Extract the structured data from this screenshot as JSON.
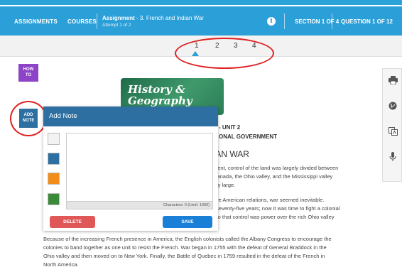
{
  "nav": {
    "assignments": "ASSIGNMENTS",
    "courses": "COURSES",
    "assignment_label": "Assignment",
    "assignment_name": "- 3. French and Indian War",
    "attempt": "Attempt 1 of 2",
    "info_icon": "i",
    "section": "SECTION 1 OF 4",
    "question": "QUESTION 1 OF 12"
  },
  "pager": {
    "pages": [
      "1",
      "2",
      "3",
      "4"
    ],
    "current": "1"
  },
  "left_buttons": {
    "how_to": [
      "HOW",
      "TO"
    ],
    "add_note": [
      "ADD",
      "NOTE"
    ]
  },
  "tools": [
    "print-icon",
    "globe-icon",
    "translate-icon",
    "microphone-icon"
  ],
  "banner": {
    "line1": "History &",
    "line2": "Geography"
  },
  "content": {
    "unit_line1": "- UNIT 2",
    "unit_line2": "ONAL GOVERNMENT",
    "heading": "IAN WAR",
    "para1": [
      "ment, control of the land was largely divided between",
      "Canada, the Ohio valley, and the Mississippi valley",
      "ery large."
    ],
    "para2": [
      "tive American relations, war seemed inevitable.",
      "f seventy-five years; now it was time to fight a colonial",
      "r to that control was power over the rich Ohio valley"
    ],
    "bottom": [
      "Because of the increasing French presence in America, the English colonists called the Albany Congress to encourage the",
      "colonies to band together as one unit to resist the French. War began in 1755 with the defeat of General Braddock in the",
      "Ohio valley and then moved on to New York. Finally, the Battle of Quebec in 1759 resulted in the defeat of the French in",
      "North America."
    ]
  },
  "modal": {
    "title": "Add Note",
    "note_value": "",
    "char_count": "Characters: 0 (Limit: 1000)",
    "delete_label": "DELETE",
    "save_label": "SAVE",
    "swatches": [
      "#f2f2f2",
      "#2c6fa0",
      "#f28c1a",
      "#3a8a3a"
    ]
  },
  "colors": {
    "header": "#2b9fd8",
    "annotation": "#e02020",
    "note_header": "#2c6fa0",
    "how_to": "#8e44c6"
  }
}
